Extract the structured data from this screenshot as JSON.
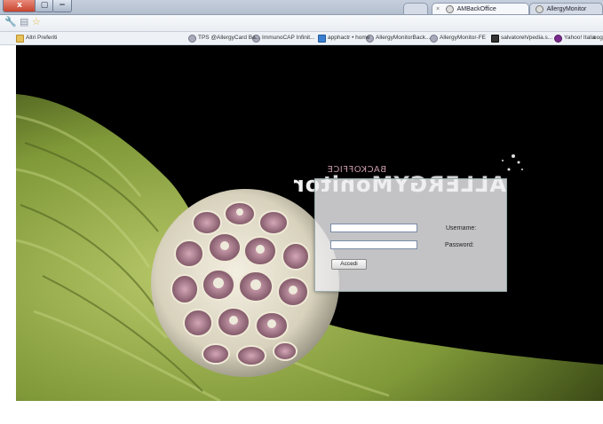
{
  "window": {
    "close_label": "x",
    "max_label": "▢",
    "min_label": "−"
  },
  "tabs": [
    {
      "label": "AMBackOffice",
      "active": true
    },
    {
      "label": "AllergyMonitor",
      "active": false
    }
  ],
  "toolbar": {
    "wrench_icon": "wrench-icon",
    "page_icon": "page-icon",
    "star_icon": "star-icon"
  },
  "bookmarks": [
    {
      "label": "oogle",
      "icon": "google-icon"
    },
    {
      "label": "Yahoo! Italia",
      "icon": "yahoo-icon"
    },
    {
      "label": "salvatoreh/pedia.s...",
      "icon": "site-icon"
    },
    {
      "label": "AllergyMonitor-FE",
      "icon": "site-icon"
    },
    {
      "label": "AllergyMonitorBack...",
      "icon": "site-icon"
    },
    {
      "label": "apphactr • home",
      "icon": "windows-icon"
    },
    {
      "label": "ImmunoCAP Infinit...",
      "icon": "site-icon"
    },
    {
      "label": "TPS @AllergyCard Ba...",
      "icon": "site-icon"
    },
    {
      "label": "Altri Preferiti",
      "icon": "folder-icon"
    }
  ],
  "logo": {
    "backoffice": "BACKOFFICE",
    "main": "ALLERGYMonitor"
  },
  "login": {
    "username_label": "Username:",
    "password_label": "Password:",
    "username_value": "",
    "password_value": "",
    "submit_label": "Accedi"
  },
  "colors": {
    "background": "#000000",
    "panel": "#eeeef0",
    "pollen_body": "#e8e4d6",
    "pollen_inner": "#b58596",
    "stem": "#8fa648"
  }
}
